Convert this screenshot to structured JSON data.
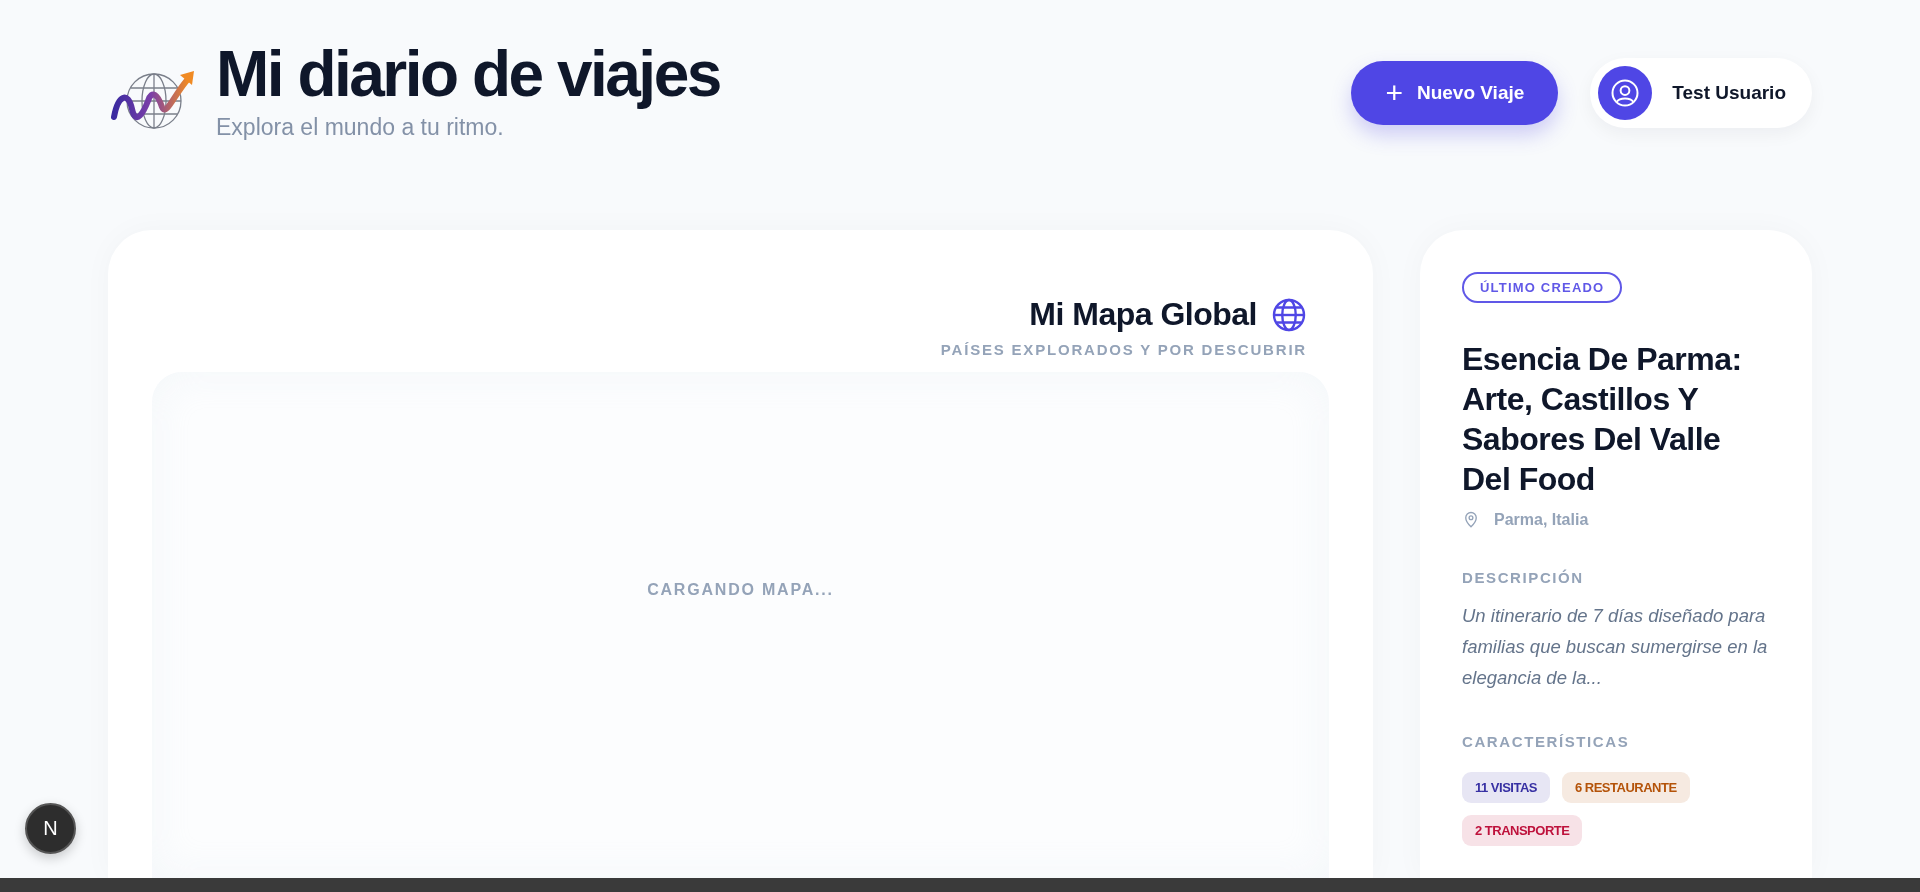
{
  "header": {
    "title": "Mi diario de viajes",
    "subtitle": "Explora el mundo a tu ritmo.",
    "new_trip_button": {
      "icon": "+",
      "label": "Nuevo Viaje"
    },
    "user": {
      "name": "Test Usuario"
    }
  },
  "map_card": {
    "title": "Mi Mapa Global",
    "subtitle": "PAÍSES EXPLORADOS Y POR DESCUBRIR",
    "loading_text": "CARGANDO MAPA..."
  },
  "latest_trip": {
    "badge": "ÚLTIMO CREADO",
    "title": "Esencia De Parma: Arte, Castillos Y Sabores Del Valle Del Food",
    "location": "Parma, Italia",
    "description_label": "DESCRIPCIÓN",
    "description": "Un itinerario de 7 días diseñado para familias que buscan sumergirse en la elegancia de la...",
    "features_label": "CARACTERÍSTICAS",
    "features": [
      {
        "label": "11 VISITAS",
        "color": "#3730a3"
      },
      {
        "label": "6 RESTAURANTE",
        "color": "#b45309"
      },
      {
        "label": "2 TRANSPORTE",
        "color": "#be123c"
      }
    ]
  },
  "dev_badge": {
    "label": "N"
  }
}
